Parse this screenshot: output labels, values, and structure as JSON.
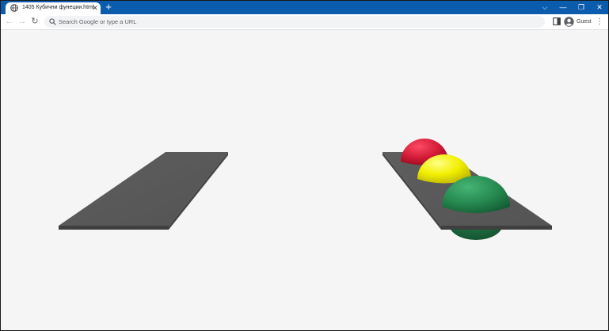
{
  "browser": {
    "tab": {
      "title": "1405 Кубични фунеции.html",
      "close_symbol": "✕"
    },
    "new_tab_symbol": "+",
    "window_controls": {
      "dropdown": "⌵",
      "minimize": "—",
      "restore": "❐",
      "close": "✕"
    },
    "nav": {
      "back": "←",
      "forward": "→",
      "reload": "↻"
    },
    "address_bar": {
      "placeholder": "Search Google or type a URL",
      "value": ""
    },
    "profile_label": "Guest",
    "menu_symbol": "⋮"
  },
  "scene": {
    "background": "#f5f5f5",
    "plate_color": "#5a5a5a",
    "sphere_colors": {
      "red": "#d01a36",
      "yellow": "#f2f000",
      "green": "#268a50"
    }
  }
}
